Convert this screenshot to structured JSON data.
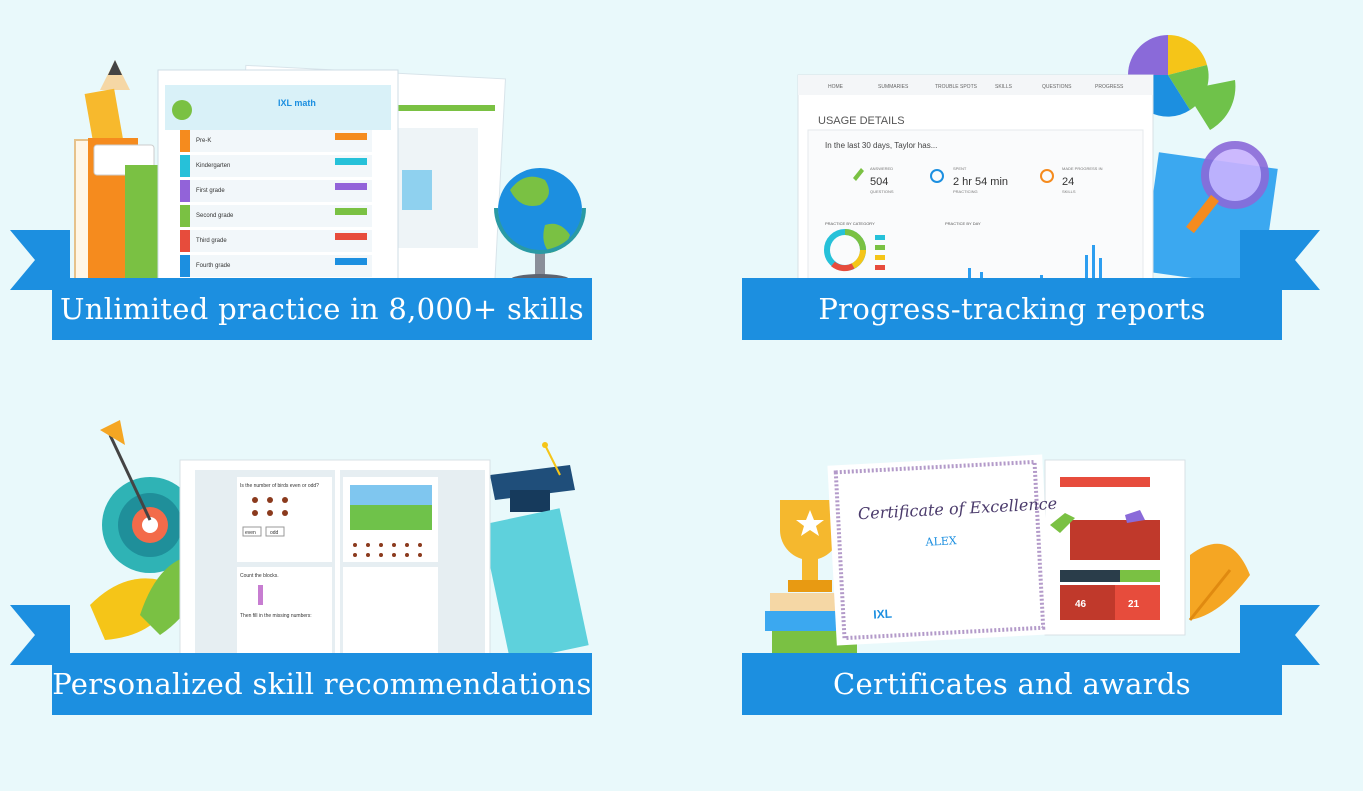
{
  "features": [
    {
      "label": "Unlimited practice in 8,000+ skills",
      "screen": {
        "logo": "IXL math",
        "grades": [
          "Pre-K",
          "Kindergarten",
          "First grade",
          "Second grade",
          "Third grade",
          "Fourth grade"
        ]
      }
    },
    {
      "label": "Progress-tracking reports",
      "screen": {
        "nav": [
          "HOME",
          "SUMMARIES",
          "TROUBLE SPOTS",
          "SKILLS",
          "QUESTIONS",
          "PROGRESS"
        ],
        "heading": "USAGE DETAILS",
        "intro": "In the last 30 days, Taylor has...",
        "stats": [
          {
            "caption": "ANSWERED",
            "value": "504",
            "unit": "QUESTIONS"
          },
          {
            "caption": "SPENT",
            "value": "2 hr 54 min",
            "unit": "PRACTICING"
          },
          {
            "caption": "MADE PROGRESS IN",
            "value": "24",
            "unit": "SKILLS"
          }
        ],
        "panel_left": "PRACTICE BY CATEGORY",
        "panel_right": "PRACTICE BY DAY"
      }
    },
    {
      "label": "Personalized skill recommendations",
      "screen": {
        "question1": "Is the number of birds even or odd?",
        "answers": [
          "even",
          "odd"
        ],
        "question2": "Count the blocks.",
        "question3": "Then fill in the missing numbers:"
      }
    },
    {
      "label": "Certificates and awards",
      "screen": {
        "certificate_title": "Certificate of Excellence",
        "certificate_name": "ALEX",
        "logo": "IXL",
        "scores": [
          "46",
          "21"
        ]
      }
    }
  ],
  "colors": {
    "background": "#e9f9fb",
    "ribbon": "#1c8fe0",
    "ribbon_dark": "#0d6fb8"
  }
}
